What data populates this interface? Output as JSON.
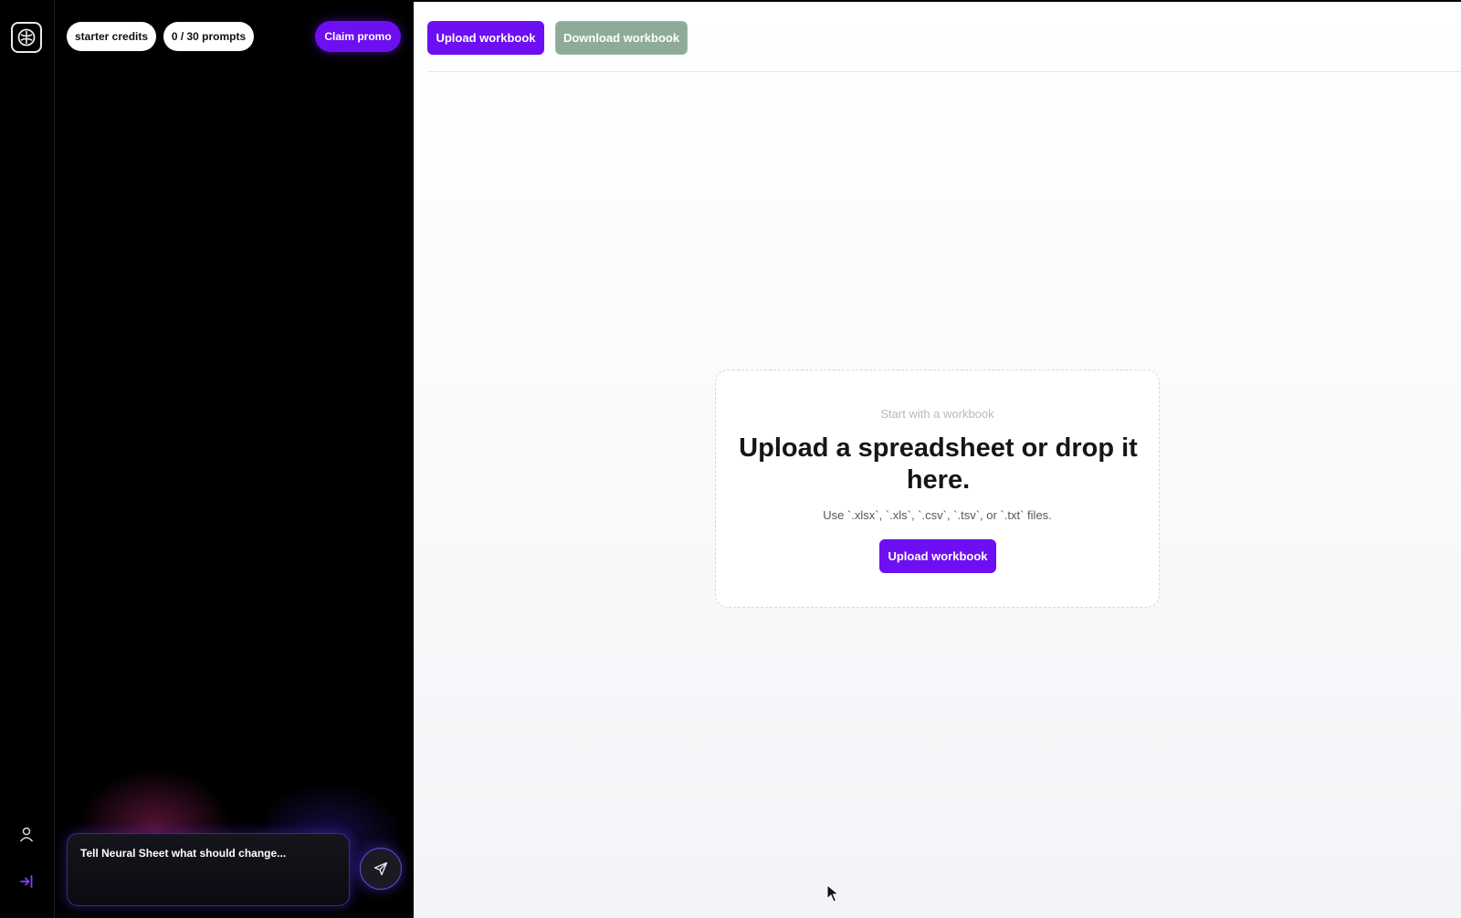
{
  "rail": {
    "logo_icon": "brain-icon",
    "user_icon": "user-icon",
    "sign_in_icon": "sign-in-icon"
  },
  "chat": {
    "credits_label": "starter credits",
    "prompts_label": "0 / 30 prompts",
    "claim_label": "Claim promo",
    "composer_placeholder": "Tell Neural Sheet what should change...",
    "send_icon": "send-icon"
  },
  "toolbar": {
    "upload_label": "Upload workbook",
    "download_label": "Download workbook"
  },
  "dropzone": {
    "kicker": "Start with a workbook",
    "heading": "Upload a spreadsheet or drop it here.",
    "hint": "Use `.xlsx`, `.xls`, `.csv`, `.tsv`, or `.txt` files.",
    "upload_label": "Upload workbook"
  },
  "colors": {
    "accent": "#6d0ff2",
    "download_disabled": "#8eab97",
    "sidebar_bg": "#000000"
  }
}
